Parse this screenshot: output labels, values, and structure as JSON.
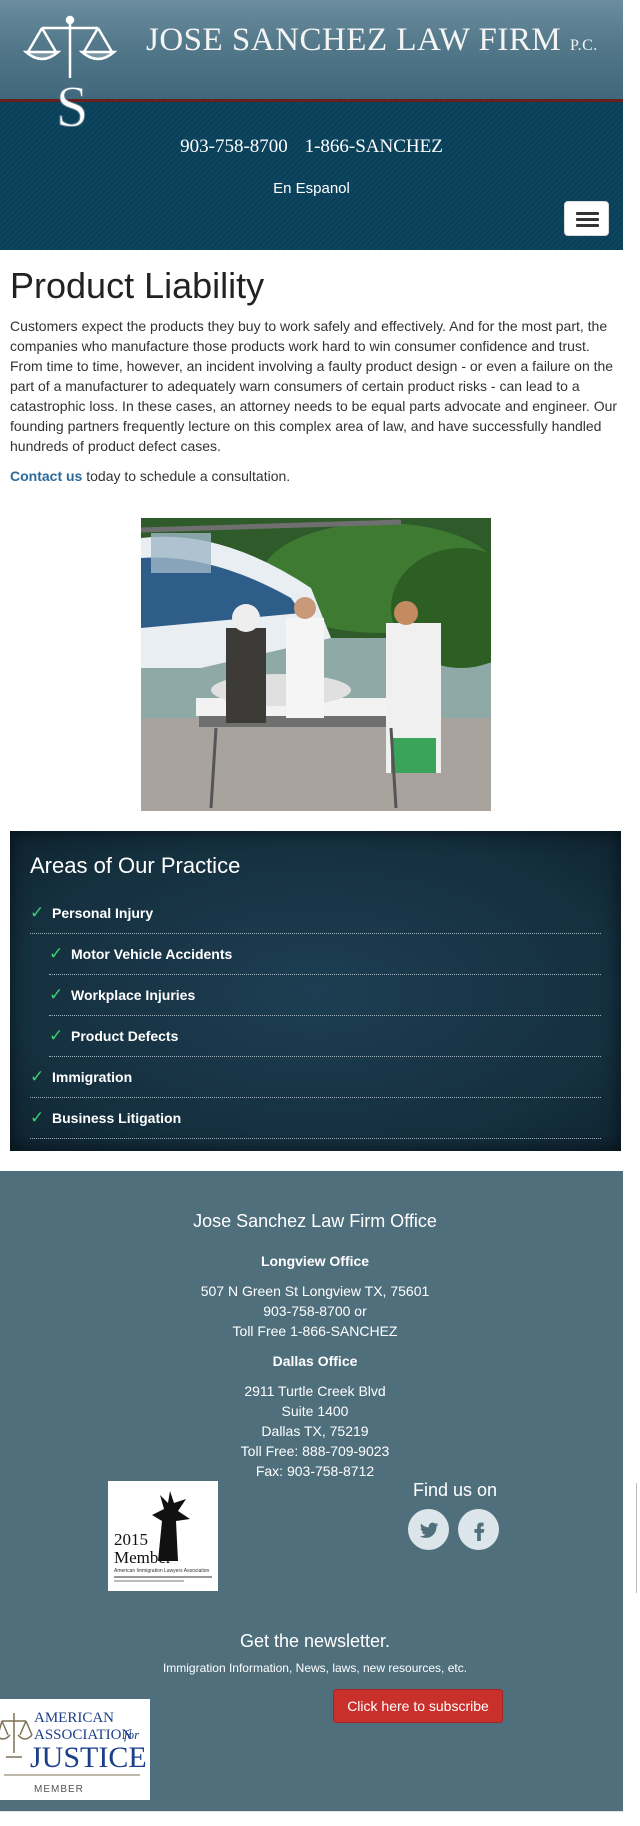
{
  "header": {
    "firm_name": "JOSE SANCHEZ LAW FIRM",
    "firm_suffix": "P.C.",
    "phone_local": "903-758-8700",
    "phone_tollfree": "1-866-SANCHEZ",
    "language_link": "En Espanol"
  },
  "page": {
    "title": "Product Liability",
    "intro": "Customers expect the products they buy to work safely and effectively. And for the most part, the companies who manufacture those products work hard to win consumer confidence and trust. From time to time, however, an incident involving a faulty product design - or even a failure on the part of a manufacturer to adequately warn consumers of certain product risks - can lead to a catastrophic loss. In these cases, an attorney needs to be equal parts advocate and engineer. Our founding partners frequently lecture on this complex area of law, and have successfully handled hundreds of product defect cases.",
    "contact_link": "Contact us",
    "contact_rest": " today to schedule a consultation."
  },
  "practice": {
    "title": "Areas of Our Practice",
    "items": [
      {
        "label": "Personal Injury"
      },
      {
        "label": "Motor Vehicle Accidents"
      },
      {
        "label": "Workplace Injuries"
      },
      {
        "label": "Product Defects"
      },
      {
        "label": "Immigration"
      },
      {
        "label": "Business Litigation"
      }
    ]
  },
  "footer": {
    "title": "Jose Sanchez Law Firm Office",
    "longview": {
      "heading": "Longview Office",
      "address": "507 N Green St Longview TX, 75601",
      "phone": "903-758-8700 or",
      "tollfree": "Toll Free 1-866-SANCHEZ"
    },
    "dallas": {
      "heading": "Dallas Office",
      "street": "2911 Turtle Creek Blvd",
      "suite": "Suite 1400",
      "city": "Dallas TX, 75219",
      "tollfree": "Toll Free: 888-709-9023",
      "fax": "Fax: 903-758-8712"
    },
    "badge_year": "2015",
    "badge_member": "Member",
    "badge_org": "American Immigration Lawyers Association",
    "find_us": "Find us on",
    "newsletter_title": "Get the newsletter.",
    "newsletter_sub": "Immigration Information, News, laws, new resources, etc.",
    "subscribe_label": "Click here to subscribe",
    "aaj_line1": "AMERICAN",
    "aaj_line2": "ASSOCIATION",
    "aaj_for": "for",
    "aaj_line3": "JUSTICE",
    "aaj_member": "MEMBER"
  },
  "icons": {
    "check": "check-icon",
    "twitter": "twitter-icon",
    "facebook": "facebook-icon",
    "menu": "hamburger-menu-icon",
    "logo": "scales-of-justice-logo"
  },
  "colors": {
    "header_dark": "#0b3f57",
    "practice_bg": "#1d3e52",
    "footer_bg": "#4f6f7d",
    "link": "#2b6a9b",
    "check": "#3bd16f",
    "subscribe": "#c9302c"
  }
}
